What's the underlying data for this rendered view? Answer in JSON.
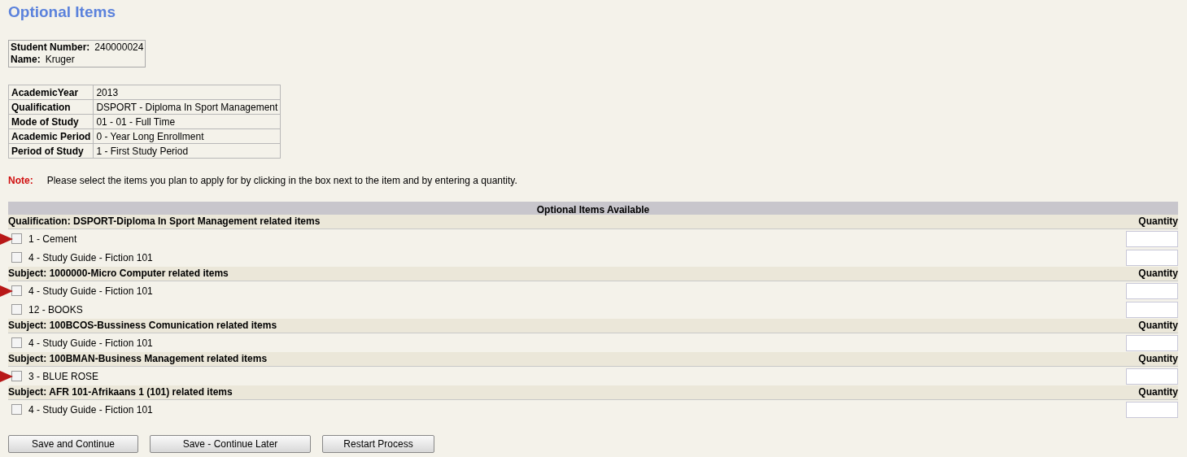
{
  "title": "Optional Items",
  "student": [
    {
      "label": "Student Number:",
      "value": "240000024"
    },
    {
      "label": "Name:",
      "value": "Kruger"
    }
  ],
  "details": [
    {
      "label": "AcademicYear",
      "value": "2013"
    },
    {
      "label": "Qualification",
      "value": "DSPORT - Diploma In Sport Management"
    },
    {
      "label": "Mode of Study",
      "value": "01 - 01 - Full Time"
    },
    {
      "label": "Academic Period",
      "value": "0 - Year Long Enrollment"
    },
    {
      "label": "Period of Study",
      "value": "1 - First Study Period"
    }
  ],
  "note": {
    "label": "Note:",
    "text": "Please select the items you plan to apply for by clicking in the box next to the item and by entering a quantity."
  },
  "items_table": {
    "title": "Optional Items Available",
    "groups": [
      {
        "heading": "Qualification: DSPORT-Diploma In Sport Management related items",
        "quantity_label": "Quantity",
        "items": [
          {
            "label": "1 - Cement",
            "checked": false,
            "flagged": true
          },
          {
            "label": "4 - Study Guide - Fiction 101",
            "checked": false,
            "flagged": false
          }
        ]
      },
      {
        "heading": "Subject: 1000000-Micro Computer related items",
        "quantity_label": "Quantity",
        "items": [
          {
            "label": "4 - Study Guide - Fiction 101",
            "checked": false,
            "flagged": true
          },
          {
            "label": "12 - BOOKS",
            "checked": false,
            "flagged": false
          }
        ]
      },
      {
        "heading": "Subject: 100BCOS-Bussiness Comunication related items",
        "quantity_label": "Quantity",
        "items": [
          {
            "label": "4 - Study Guide - Fiction 101",
            "checked": false,
            "flagged": false
          }
        ]
      },
      {
        "heading": "Subject: 100BMAN-Business Management related items",
        "quantity_label": "Quantity",
        "items": [
          {
            "label": "3 - BLUE ROSE",
            "checked": false,
            "flagged": true
          }
        ]
      },
      {
        "heading": "Subject: AFR 101-Afrikaans 1 (101) related items",
        "quantity_label": "Quantity",
        "items": [
          {
            "label": "4 - Study Guide - Fiction 101",
            "checked": false,
            "flagged": false
          }
        ]
      }
    ]
  },
  "buttons": [
    "Save and Continue",
    "Save - Continue Later",
    "Restart Process"
  ]
}
